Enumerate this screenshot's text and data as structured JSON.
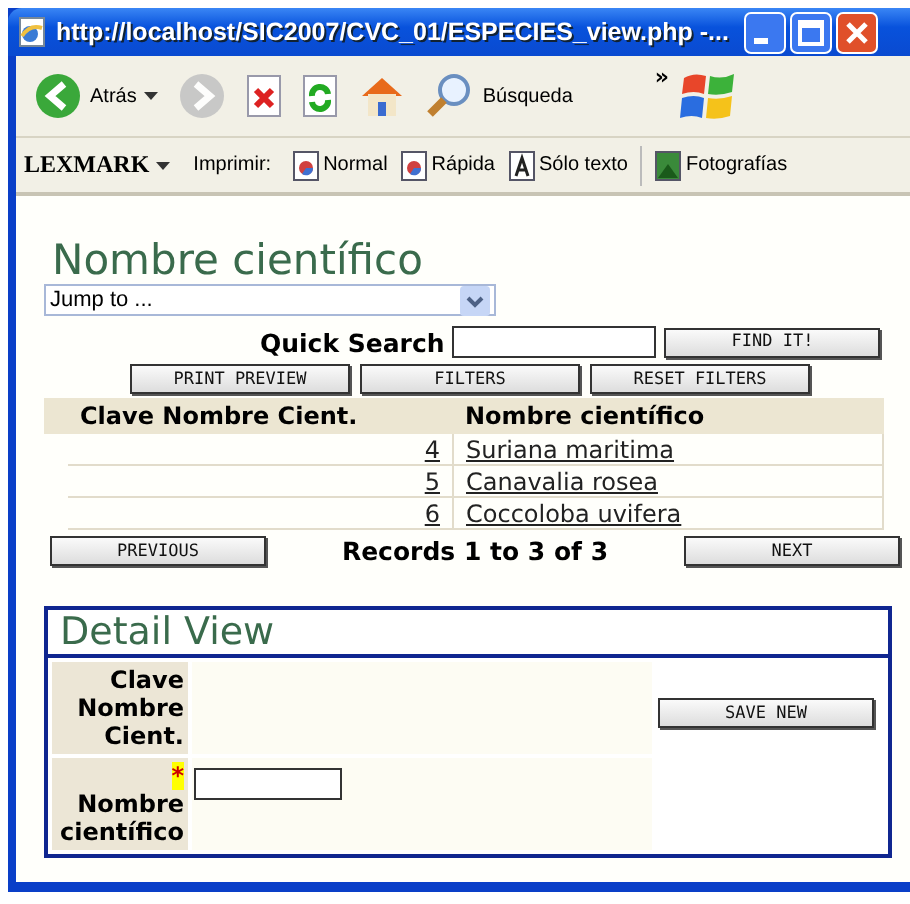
{
  "window": {
    "title": "http://localhost/SIC2007/CVC_01/ESPECIES_view.php -..."
  },
  "toolbar": {
    "items": [
      {
        "kind": "back",
        "label": "Atrás",
        "disabled": false
      },
      {
        "kind": "forward",
        "disabled": true
      },
      {
        "kind": "stop",
        "disabled": false
      },
      {
        "kind": "refresh",
        "disabled": false
      },
      {
        "kind": "home",
        "disabled": false
      },
      {
        "kind": "search",
        "label": "Búsqueda",
        "disabled": false
      }
    ],
    "overflow": "»"
  },
  "print_bar": {
    "brand": "LEXMARK",
    "label": "Imprimir:",
    "buttons": [
      {
        "kind": "page",
        "label": "Normal"
      },
      {
        "kind": "page",
        "label": "Rápida"
      },
      {
        "kind": "text",
        "label": "Sólo texto"
      },
      {
        "kind": "photo",
        "label": "Fotografías"
      }
    ]
  },
  "page": {
    "heading": "Nombre científico",
    "jump_select": {
      "value": "Jump to ..."
    },
    "quick_search": {
      "label": "Quick Search",
      "button": "FIND IT!"
    },
    "buttons": [
      "PRINT PREVIEW",
      "FILTERS",
      "RESET FILTERS"
    ],
    "table": {
      "columns": [
        "Clave Nombre Cient.",
        "Nombre científico"
      ],
      "rows": [
        {
          "clave": "4",
          "nombre": "Suriana maritima"
        },
        {
          "clave": "5",
          "nombre": "Canavalia rosea"
        },
        {
          "clave": "6",
          "nombre": "Coccoloba uvifera"
        }
      ]
    },
    "pager": {
      "previous": "PREVIOUS",
      "summary": "Records 1 to 3 of 3",
      "next": "NEXT"
    },
    "detail": {
      "heading": "Detail View",
      "button": "SAVE NEW",
      "fields": [
        {
          "kind": "readonly",
          "label": "Clave Nombre Cient."
        },
        {
          "kind": "input",
          "label": "Nombre científico",
          "required_mark": "*"
        }
      ]
    }
  }
}
